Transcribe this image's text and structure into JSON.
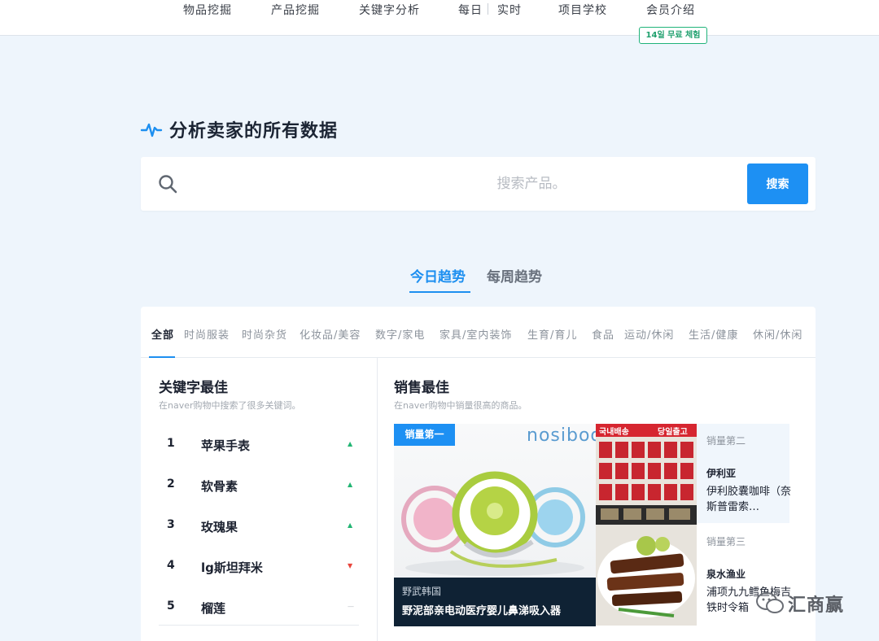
{
  "nav": {
    "items": [
      "物品挖掘",
      "产品挖掘",
      "关键字分析",
      "每日",
      "实时",
      "项目学校",
      "会员介绍"
    ],
    "trial_badge": "14일 무료 체험"
  },
  "hero": {
    "title": "分析卖家的所有数据"
  },
  "search": {
    "placeholder": "搜索产品。",
    "button": "搜索"
  },
  "trend_tabs": [
    "今日趋势",
    "每周趋势"
  ],
  "categories": [
    "全部",
    "时尚服装",
    "时尚杂货",
    "化妆品/美容",
    "数字/家电",
    "家具/室内装饰",
    "生育/育儿",
    "食品",
    "运动/休闲",
    "生活/健康",
    "休闲/休闲"
  ],
  "keywords": {
    "title": "关键字最佳",
    "subtitle": "在naver购物中搜索了很多关键词。",
    "items": [
      {
        "rank": "1",
        "name": "苹果手表",
        "trend": "up"
      },
      {
        "rank": "2",
        "name": "软骨素",
        "trend": "up"
      },
      {
        "rank": "3",
        "name": "玫瑰果",
        "trend": "up"
      },
      {
        "rank": "4",
        "name": "lg斯坦拜米",
        "trend": "down"
      },
      {
        "rank": "5",
        "name": "榴莲",
        "trend": "flat"
      }
    ]
  },
  "sales": {
    "title": "销售最佳",
    "subtitle": "在naver购物中销量很高的商品。",
    "main": {
      "badge": "销量第一",
      "logo": "nosiboo",
      "brand": "野武韩国",
      "name": "野泥部亲电动医疗婴儿鼻涕吸入器"
    },
    "second": {
      "rank": "销量第二",
      "brand": "伊利亚",
      "name": "伊利胶囊咖啡（奈斯普雷索…",
      "banner1": "국내배송",
      "banner2": "당일출고"
    },
    "third": {
      "rank": "销量第三",
      "brand": "泉水渔业",
      "name": "浦项九九鳕鱼梅吉铁时令箱"
    }
  },
  "watermark": "汇商赢",
  "colors": {
    "accent": "#1d90f3",
    "up": "#22b573",
    "down": "#e8453c",
    "badge_green": "#20b37a"
  }
}
